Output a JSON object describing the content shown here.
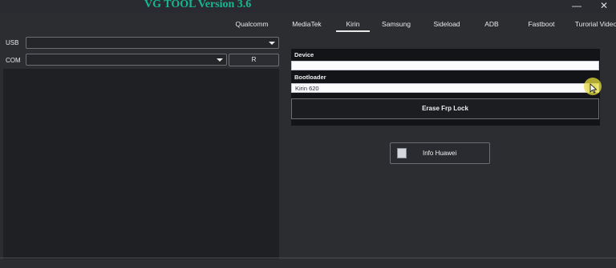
{
  "window": {
    "title": "VG TOOL Version 3.6",
    "minimize_glyph": "—",
    "close_glyph": "✕"
  },
  "tabs": [
    {
      "label": "Qualcomm",
      "active": false
    },
    {
      "label": "MediaTek",
      "active": false
    },
    {
      "label": "Kirin",
      "active": true
    },
    {
      "label": "Samsung",
      "active": false
    },
    {
      "label": "Sideload",
      "active": false
    },
    {
      "label": "ADB",
      "active": false
    },
    {
      "label": "Fastboot",
      "active": false
    },
    {
      "label": "Turorial Video",
      "active": false
    }
  ],
  "connection": {
    "usb_label": "USB",
    "usb_value": "",
    "com_label": "COM",
    "com_value": "",
    "refresh_label": "R"
  },
  "kirin_panel": {
    "device_label": "Device",
    "device_value": "",
    "bootloader_label": "Bootloader",
    "bootloader_value": "Kirin 620",
    "erase_button": "Erase Frp Lock",
    "info_button": "Info Huawei"
  },
  "icons": {
    "dropdown": "chevron-down-icon",
    "info": "phone-icon",
    "pointer": "mouse-cursor-icon"
  },
  "colors": {
    "background": "#2b2d31",
    "title": "#17b793",
    "panel": "#131417",
    "cursor_highlight": "#e6dc3c"
  }
}
